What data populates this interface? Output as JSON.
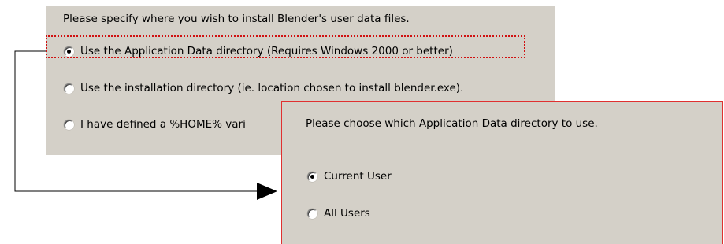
{
  "installer": {
    "prompt": "Please specify where you wish to install Blender's user data files.",
    "options": [
      {
        "label": "Use the Application Data directory (Requires Windows 2000 or better)",
        "selected": true
      },
      {
        "label": "Use the installation directory (ie. location chosen to install blender.exe).",
        "selected": false
      },
      {
        "label": "I have defined a %HOME% vari",
        "selected": false
      }
    ]
  },
  "appdata_dialog": {
    "prompt": "Please choose which Application Data directory to use.",
    "options": [
      {
        "label": "Current User",
        "selected": true
      },
      {
        "label": "All Users",
        "selected": false
      }
    ]
  },
  "colors": {
    "dialog_background": "#d4d0c8",
    "highlight": "#d01010",
    "arrow": "#000000"
  }
}
